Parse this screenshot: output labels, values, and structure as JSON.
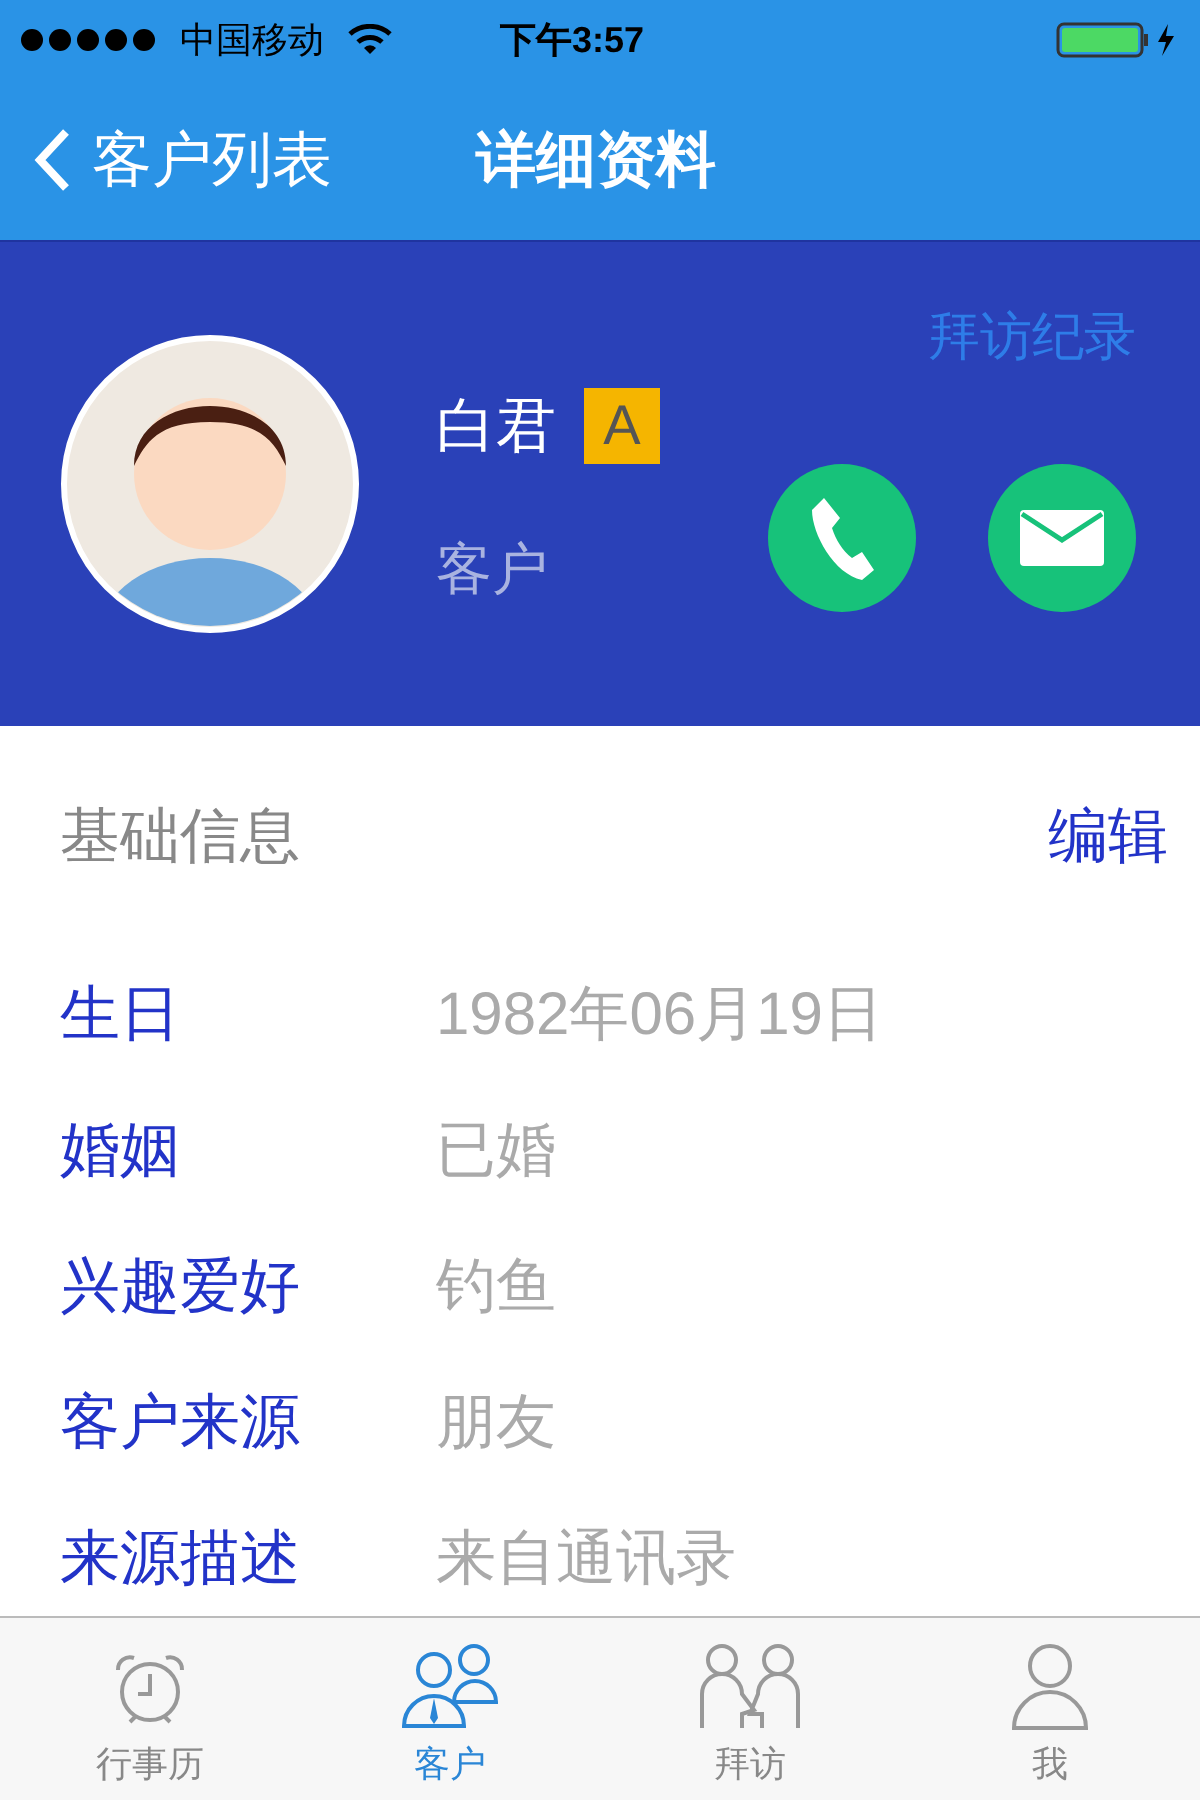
{
  "status_bar": {
    "carrier": "中国移动",
    "time": "下午3:57",
    "battery": {
      "level": 1
    }
  },
  "nav": {
    "back": "客户列表",
    "title": "详细资料"
  },
  "profile": {
    "visit_link": "拜访纪录",
    "name": "白君",
    "grade": "A",
    "role": "客户"
  },
  "section": {
    "title": "基础信息",
    "action": "编辑"
  },
  "fields": [
    {
      "label": "生日",
      "value": "1982年06月19日"
    },
    {
      "label": "婚姻",
      "value": "已婚"
    },
    {
      "label": "兴趣爱好",
      "value": "钓鱼"
    },
    {
      "label": "客户来源",
      "value": "朋友"
    },
    {
      "label": "来源描述",
      "value": "来自通讯录"
    }
  ],
  "tabs": [
    {
      "label": "行事历",
      "kind": "calendar",
      "selected": false
    },
    {
      "label": "客户",
      "kind": "customers",
      "selected": true
    },
    {
      "label": "拜访",
      "kind": "visit",
      "selected": false
    },
    {
      "label": "我",
      "kind": "me",
      "selected": false
    }
  ]
}
